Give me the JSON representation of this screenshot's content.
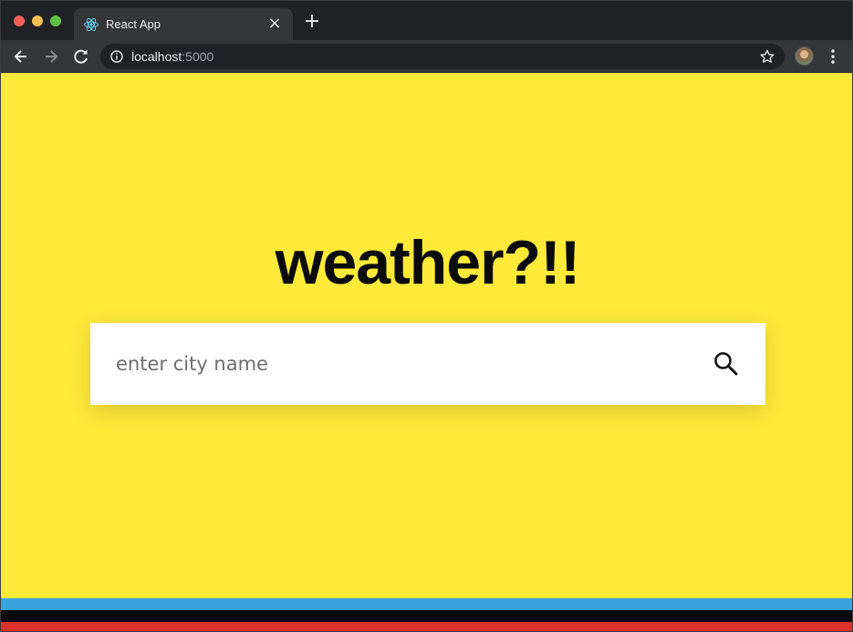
{
  "browser": {
    "tab": {
      "title": "React App",
      "favicon": "react-icon"
    },
    "url": {
      "host": "localhost",
      "port": ":5000"
    },
    "icons": [
      "back-icon",
      "forward-icon",
      "reload-icon",
      "info-icon",
      "star-icon",
      "menu-icon"
    ]
  },
  "page": {
    "heading": "weather?!!",
    "search": {
      "placeholder": "enter city name",
      "value": "",
      "icon": "search-icon"
    },
    "colors": {
      "background": "#ffea3a",
      "stripes": [
        "#3aa3de",
        "#0a0a0a",
        "#e0302c"
      ]
    }
  }
}
